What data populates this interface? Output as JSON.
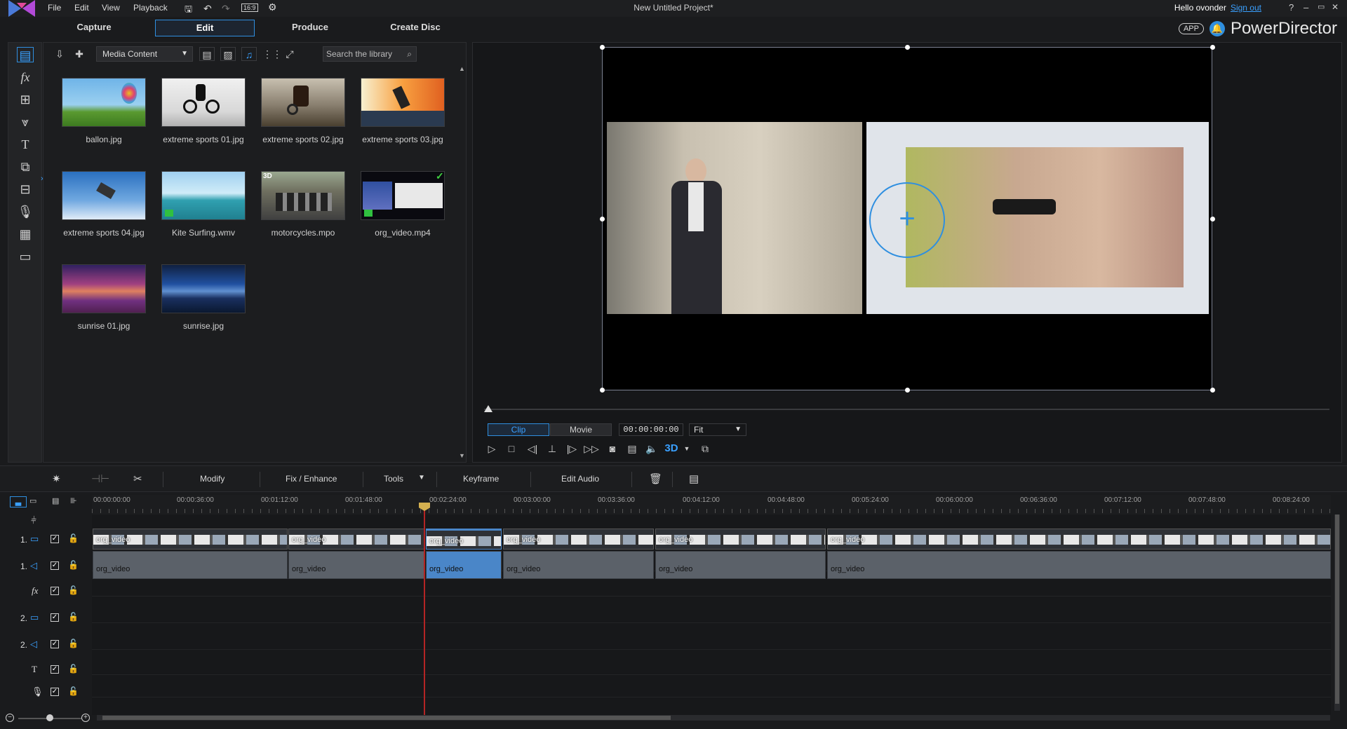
{
  "app": {
    "title": "New Untitled Project*",
    "brand": "PowerDirector",
    "app_badge": "APP"
  },
  "menu": {
    "file": "File",
    "edit": "Edit",
    "view": "View",
    "playback": "Playback",
    "aspect": "16:9"
  },
  "user": {
    "greeting": "Hello ovonder",
    "signout": "Sign out"
  },
  "window_buttons": {
    "help": "?",
    "minimize": "–",
    "restore": "▭",
    "close": "✕"
  },
  "modes": {
    "capture": "Capture",
    "edit": "Edit",
    "produce": "Produce",
    "create_disc": "Create Disc"
  },
  "library": {
    "media_select": "Media Content",
    "search_placeholder": "Search the library",
    "items": [
      {
        "label": "ballon.jpg"
      },
      {
        "label": "extreme sports 01.jpg"
      },
      {
        "label": "extreme sports 02.jpg"
      },
      {
        "label": "extreme sports 03.jpg"
      },
      {
        "label": "extreme sports 04.jpg"
      },
      {
        "label": "Kite Surfing.wmv"
      },
      {
        "label": "motorcycles.mpo",
        "badge": "3D"
      },
      {
        "label": "org_video.mp4",
        "check": "✓"
      },
      {
        "label": "sunrise 01.jpg"
      },
      {
        "label": "sunrise.jpg"
      }
    ]
  },
  "preview": {
    "clip_tab": "Clip",
    "movie_tab": "Movie",
    "timecode": "00:00:00:00",
    "fit": "Fit",
    "threed": "3D"
  },
  "edit_toolbar": {
    "modify": "Modify",
    "fix_enhance": "Fix / Enhance",
    "tools": "Tools",
    "keyframe": "Keyframe",
    "edit_audio": "Edit Audio"
  },
  "timeline": {
    "ticks": [
      "00:00:00:00",
      "00:00:36:00",
      "00:01:12:00",
      "00:01:48:00",
      "00:02:24:00",
      "00:03:00:00",
      "00:03:36:00",
      "00:04:12:00",
      "00:04:48:00",
      "00:05:24:00",
      "00:06:00:00",
      "00:06:36:00",
      "00:07:12:00",
      "00:07:48:00",
      "00:08:24:00"
    ],
    "tracks": [
      {
        "num": "1.",
        "kind": "video"
      },
      {
        "num": "1.",
        "kind": "audio"
      },
      {
        "num": "",
        "kind": "fx"
      },
      {
        "num": "2.",
        "kind": "video"
      },
      {
        "num": "2.",
        "kind": "audio"
      },
      {
        "num": "",
        "kind": "title"
      },
      {
        "num": "",
        "kind": "voice"
      }
    ],
    "clip_label": "org_video"
  },
  "colors": {
    "accent": "#2f8fe0",
    "playhead": "#b42424",
    "selected_clip": "#4a86c8"
  }
}
